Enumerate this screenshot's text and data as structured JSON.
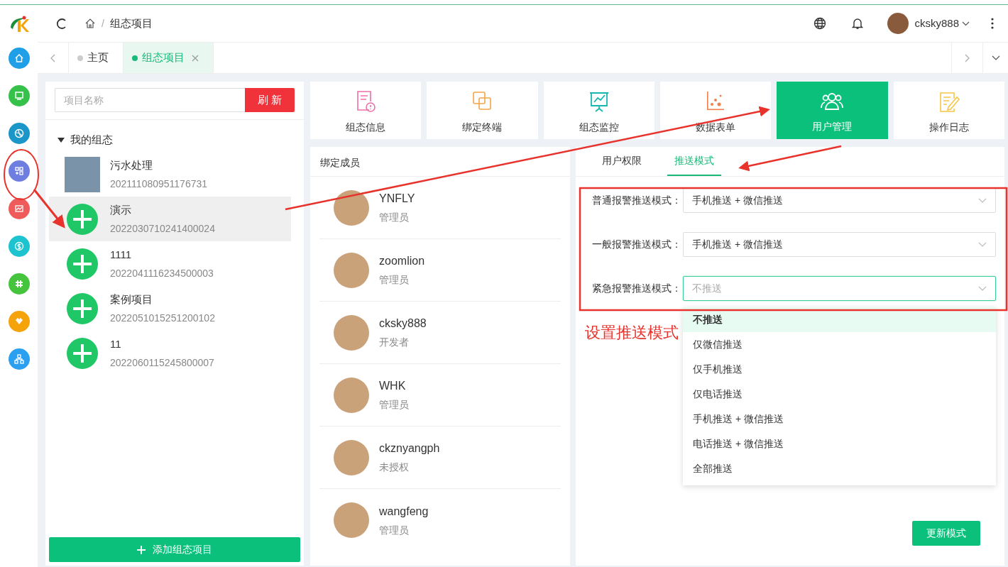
{
  "header": {
    "separator": "/",
    "breadcrumb": "组态项目",
    "user": "cksky888"
  },
  "tabs": [
    {
      "label": "主页",
      "selected": false,
      "closable": false
    },
    {
      "label": "组态项目",
      "selected": true,
      "closable": true
    }
  ],
  "search": {
    "placeholder": "项目名称",
    "button": "刷 新"
  },
  "tree": {
    "label": "我的组态",
    "expanded": true,
    "children": [
      {
        "name": "污水处理",
        "id": "202111080951176731",
        "kind": "photo",
        "selected": false
      },
      {
        "name": "演示",
        "id": "2022030710241400024",
        "kind": "plus",
        "selected": true
      },
      {
        "name": "1111",
        "id": "2022041116234500003",
        "kind": "plus",
        "selected": false
      },
      {
        "name": "案例项目",
        "id": "2022051015251200102",
        "kind": "plus",
        "selected": false
      },
      {
        "name": "11",
        "id": "2022060115245800007",
        "kind": "plus",
        "selected": false
      }
    ]
  },
  "add_button": "添加组态项目",
  "modules": [
    {
      "label": "组态信息",
      "kind": "info",
      "selected": false
    },
    {
      "label": "绑定终端",
      "kind": "terminal",
      "selected": false
    },
    {
      "label": "组态监控",
      "kind": "monitor",
      "selected": false
    },
    {
      "label": "数据表单",
      "kind": "chart",
      "selected": false
    },
    {
      "label": "用户管理",
      "kind": "users",
      "selected": true
    },
    {
      "label": "操作日志",
      "kind": "log",
      "selected": false
    }
  ],
  "members": {
    "title": "绑定成员",
    "items": [
      {
        "name": "YNFLY",
        "role": "管理员"
      },
      {
        "name": "zoomlion",
        "role": "管理员"
      },
      {
        "name": "cksky888",
        "role": "开发者"
      },
      {
        "name": "WHK",
        "role": "管理员"
      },
      {
        "name": "ckznyangph",
        "role": "未授权"
      },
      {
        "name": "wangfeng",
        "role": "管理员"
      }
    ]
  },
  "push": {
    "tabs": [
      {
        "label": "用户权限",
        "selected": false
      },
      {
        "label": "推送模式",
        "selected": true
      }
    ],
    "fields": [
      {
        "label": "普通报警推送模式：",
        "value": "手机推送 + 微信推送",
        "focused": false
      },
      {
        "label": "一般报警推送模式：",
        "value": "手机推送 + 微信推送",
        "focused": false
      },
      {
        "label": "紧急报警推送模式：",
        "placeholder": "不推送",
        "focused": true
      }
    ],
    "options": [
      {
        "label": "不推送",
        "selected": true
      },
      {
        "label": "仅微信推送",
        "selected": false
      },
      {
        "label": "仅手机推送",
        "selected": false
      },
      {
        "label": "仅电话推送",
        "selected": false
      },
      {
        "label": "手机推送 + 微信推送",
        "selected": false
      },
      {
        "label": "电话推送 + 微信推送",
        "selected": false
      },
      {
        "label": "全部推送",
        "selected": false
      }
    ],
    "button": "更新模式"
  },
  "annotation": {
    "note": "设置推送模式"
  }
}
